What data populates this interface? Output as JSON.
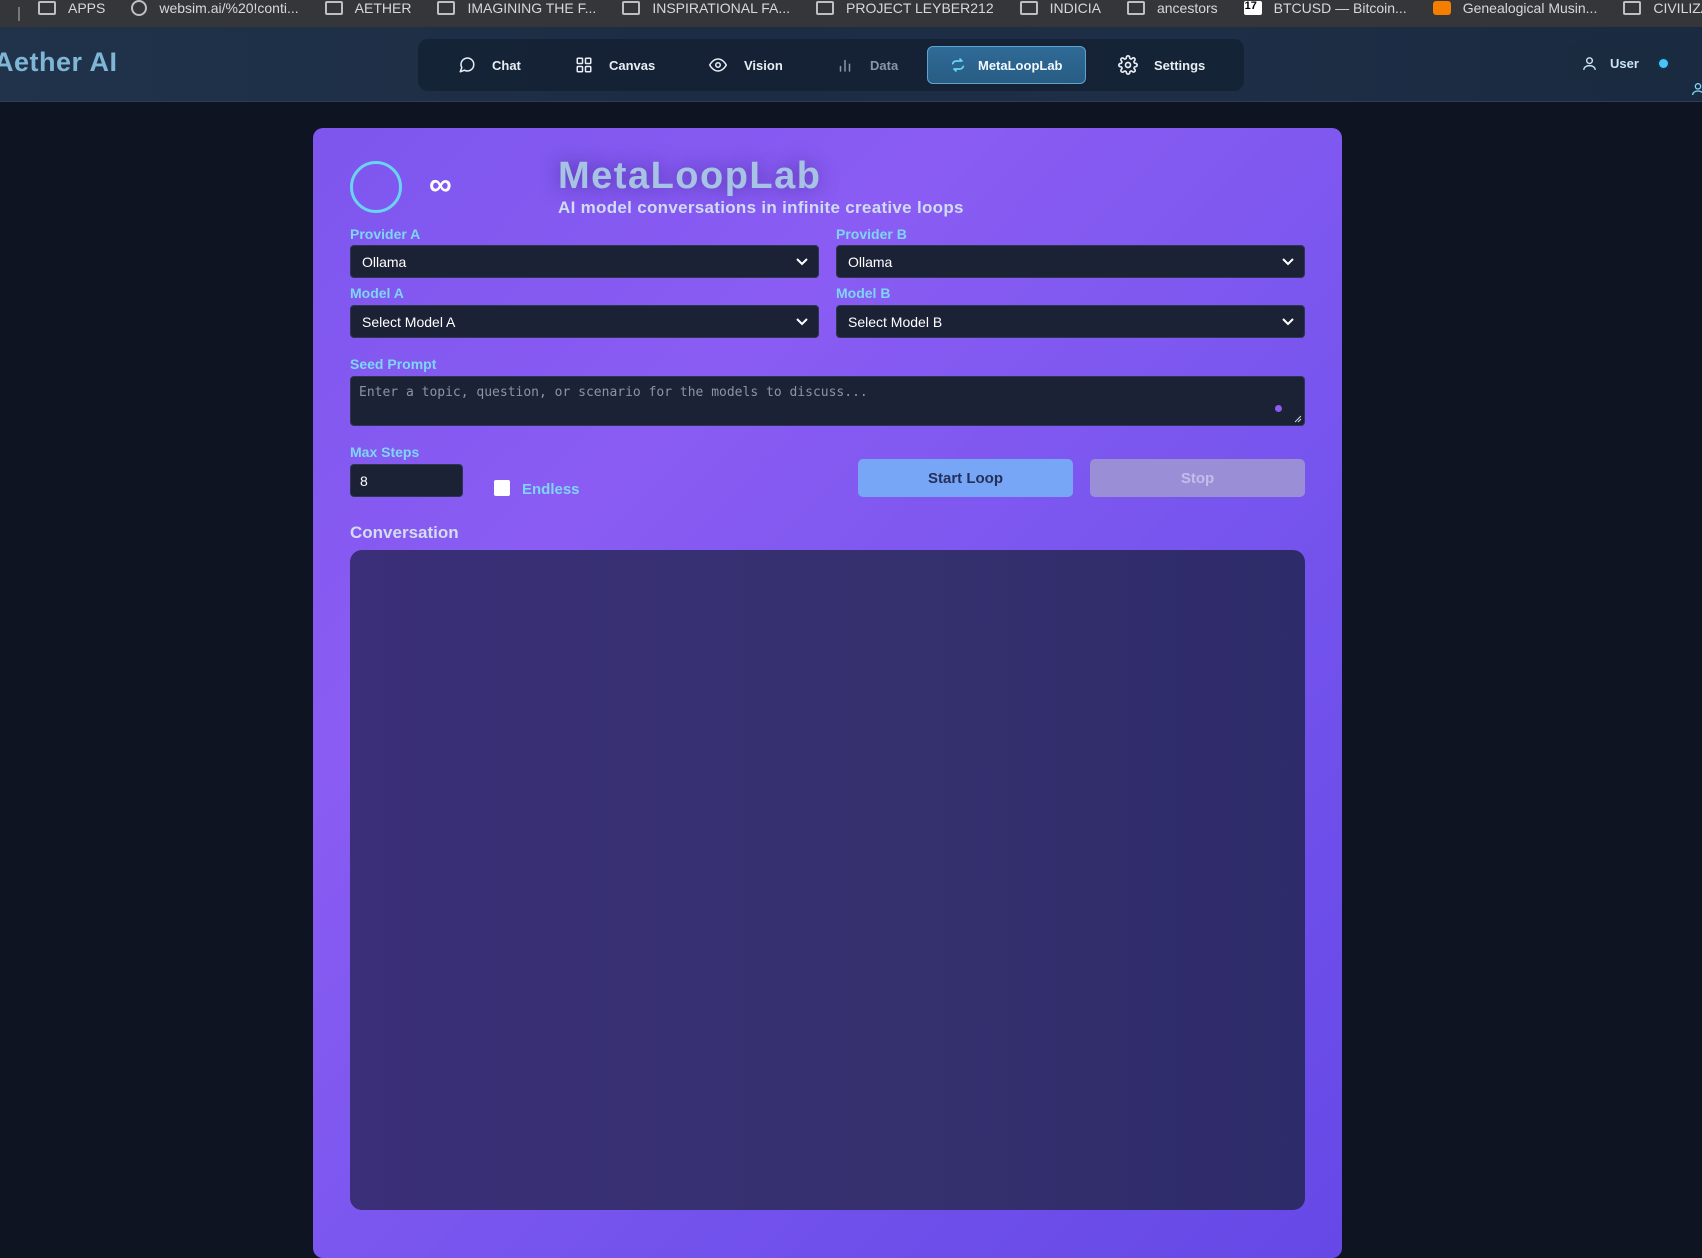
{
  "bookmarks": [
    {
      "label": "APPS",
      "icon": "folder-icon"
    },
    {
      "label": "websim.ai/%20!conti...",
      "icon": "globe-icon"
    },
    {
      "label": "AETHER",
      "icon": "folder-icon"
    },
    {
      "label": "IMAGINING THE F...",
      "icon": "folder-icon"
    },
    {
      "label": "INSPIRATIONAL FA...",
      "icon": "folder-icon"
    },
    {
      "label": "PROJECT LEYBER212",
      "icon": "folder-icon"
    },
    {
      "label": "INDICIA",
      "icon": "folder-icon"
    },
    {
      "label": "ancestors",
      "icon": "folder-icon"
    },
    {
      "label": "BTCUSD — Bitcoin...",
      "icon": "tradingview-icon"
    },
    {
      "label": "Genealogical Musin...",
      "icon": "blogger-icon"
    },
    {
      "label": "CIVILIZAT",
      "icon": "folder-icon"
    }
  ],
  "header": {
    "brand": "Aether AI",
    "nav": [
      {
        "label": "Chat",
        "icon": "chat-bubble-icon"
      },
      {
        "label": "Canvas",
        "icon": "grid-icon"
      },
      {
        "label": "Vision",
        "icon": "eye-icon"
      },
      {
        "label": "Data",
        "icon": "bar-chart-icon"
      },
      {
        "label": "MetaLoopLab",
        "icon": "loop-icon",
        "active": true
      },
      {
        "label": "Settings",
        "icon": "gear-icon"
      }
    ],
    "user_label": "User"
  },
  "main": {
    "logo_symbol": "∞",
    "title": "MetaLoopLab",
    "subtitle": "AI model conversations in infinite creative loops",
    "provider_a": {
      "label": "Provider A",
      "value": "Ollama"
    },
    "provider_b": {
      "label": "Provider B",
      "value": "Ollama"
    },
    "model_a": {
      "label": "Model A",
      "value": "Select Model A"
    },
    "model_b": {
      "label": "Model B",
      "value": "Select Model B"
    },
    "seed": {
      "label": "Seed Prompt",
      "placeholder": "Enter a topic, question, or scenario for the models to discuss..."
    },
    "max_steps": {
      "label": "Max Steps",
      "value": "8"
    },
    "endless_label": "Endless",
    "start_label": "Start Loop",
    "stop_label": "Stop",
    "conversation_title": "Conversation"
  },
  "colors": {
    "accent": "#7ed6f6",
    "panel": "#8a5cf3",
    "start_button": "#76a6f5",
    "stop_button": "#9a8fd6"
  }
}
